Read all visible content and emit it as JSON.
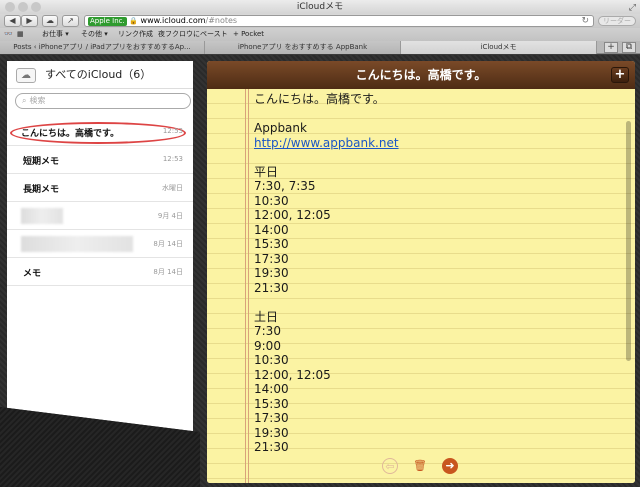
{
  "window": {
    "title": "iCloudメモ"
  },
  "toolbar": {
    "back": "◀",
    "forward": "▶",
    "share": "↗",
    "ev_label": "Apple Inc.",
    "url_host": "www.icloud.com",
    "url_path": "/#notes",
    "reader_label": "リーダー"
  },
  "bookmarks": [
    "お仕事 ▾",
    "その他 ▾",
    "リンク作成",
    "夜フクロウにペースト",
    "+ Pocket"
  ],
  "tabs": [
    {
      "label": "Posts ‹ iPhoneアプリ / iPadアプリをおすすめするAp..."
    },
    {
      "label": "iPhoneアプリ をおすすめする AppBank"
    },
    {
      "label": "iCloudメモ"
    }
  ],
  "sidebar": {
    "title": "すべてのiCloud（6）",
    "search_placeholder": "検索",
    "notes": [
      {
        "title": "こんにちは。高橋です。",
        "date": "12:53",
        "selected": true
      },
      {
        "title": "短期メモ",
        "date": "12:53"
      },
      {
        "title": "長期メモ",
        "date": "水曜日"
      },
      {
        "title": "",
        "date": "9月 4日",
        "blurred": true
      },
      {
        "title": "",
        "date": "8月 14日",
        "blurred": true
      },
      {
        "title": "メモ",
        "date": "8月 14日"
      }
    ]
  },
  "note": {
    "header_title": "こんにちは。高橋です。",
    "line_greeting": "こんにちは。高橋です。",
    "appbank": "Appbank",
    "link": "http://www.appbank.net",
    "weekday_label": "平日",
    "weekday_times": "7:30, 7:35\n10:30\n12:00, 12:05\n14:00\n15:30\n17:30\n19:30\n21:30",
    "saturday_label": "土日",
    "saturday_times": "7:30\n9:00\n10:30\n12:00, 12:05\n14:00\n15:30\n17:30\n19:30\n21:30"
  },
  "icons": {
    "cloud": "cloud-icon",
    "search": "search-icon",
    "add": "plus-icon",
    "prev": "prev-arrow-icon",
    "trash": "trash-icon",
    "next": "next-arrow-icon"
  },
  "colors": {
    "header_brown": "#6b3e20",
    "paper_yellow": "#fbf3a3",
    "link_blue": "#1a55c7",
    "selection_ring": "#dd4444",
    "footer_icon": "#c8561f"
  }
}
